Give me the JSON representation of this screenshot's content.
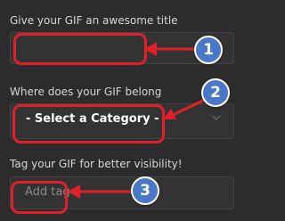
{
  "title_section": {
    "label": "Give your GIF an awesome title",
    "value": ""
  },
  "category_section": {
    "label": "Where does your GIF belong",
    "selected": "- Select a Category -"
  },
  "tag_section": {
    "label": "Tag your GIF for better visibility!",
    "placeholder": "Add tag"
  },
  "callouts": [
    "1",
    "2",
    "3"
  ],
  "colors": {
    "background": "#2c2c2c",
    "field": "#333333",
    "highlight": "#e0202a",
    "badge": "#4a78c8"
  }
}
